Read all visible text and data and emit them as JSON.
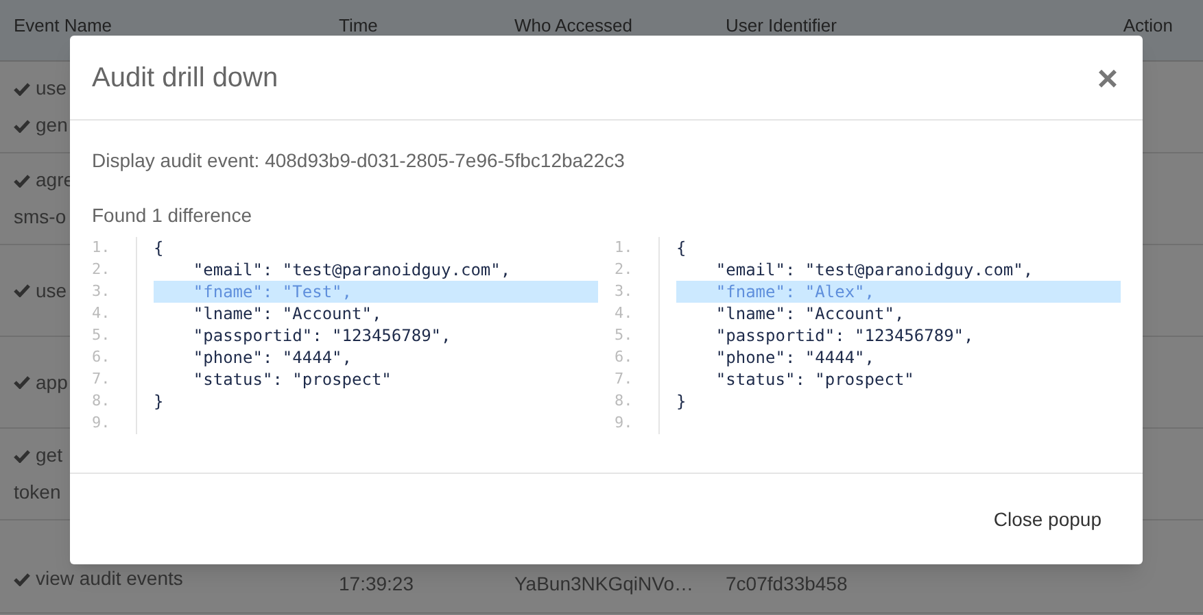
{
  "table": {
    "columns": [
      "Event Name",
      "Time",
      "Who Accessed",
      "User Identifier",
      "Action"
    ],
    "rows": [
      {
        "event": [
          {
            "kind": "check",
            "text": "use"
          },
          {
            "kind": "check",
            "text": "gen"
          }
        ]
      },
      {
        "event": [
          {
            "kind": "check",
            "text": "agre"
          },
          {
            "kind": "text",
            "text": "sms-o"
          }
        ]
      },
      {
        "event": [
          {
            "kind": "check",
            "text": "use"
          }
        ]
      },
      {
        "event": [
          {
            "kind": "check",
            "text": "app"
          }
        ]
      },
      {
        "event": [
          {
            "kind": "check",
            "text": "get"
          },
          {
            "kind": "text",
            "text": "token"
          }
        ]
      },
      {
        "event": [
          {
            "kind": "check",
            "text": "view audit events"
          }
        ],
        "time": "17:39:23",
        "who": "YaBun3NKGqiNVo…",
        "user_id": "7c07fd33b458"
      }
    ]
  },
  "modal": {
    "title": "Audit drill down",
    "close": "×",
    "event_line": "Display audit event: 408d93b9-d031-2805-7e96-5fbc12ba22c3",
    "summary": "Found 1 difference",
    "panes": [
      {
        "lines": [
          {
            "number": "1.",
            "text": "{",
            "changed": false
          },
          {
            "number": "2.",
            "text": "    \"email\": \"test@paranoidguy.com\",",
            "changed": false
          },
          {
            "number": "3.",
            "text": "    \"fname\": \"Test\",",
            "changed": true
          },
          {
            "number": "4.",
            "text": "    \"lname\": \"Account\",",
            "changed": false
          },
          {
            "number": "5.",
            "text": "    \"passportid\": \"123456789\",",
            "changed": false
          },
          {
            "number": "6.",
            "text": "    \"phone\": \"4444\",",
            "changed": false
          },
          {
            "number": "7.",
            "text": "    \"status\": \"prospect\"",
            "changed": false
          },
          {
            "number": "8.",
            "text": "}",
            "changed": false
          },
          {
            "number": "9."
          }
        ]
      },
      {
        "lines": [
          {
            "number": "1.",
            "text": "{",
            "changed": false
          },
          {
            "number": "2.",
            "text": "    \"email\": \"test@paranoidguy.com\",",
            "changed": false
          },
          {
            "number": "3.",
            "text": "    \"fname\": \"Alex\",",
            "changed": true
          },
          {
            "number": "4.",
            "text": "    \"lname\": \"Account\",",
            "changed": false
          },
          {
            "number": "5.",
            "text": "    \"passportid\": \"123456789\",",
            "changed": false
          },
          {
            "number": "6.",
            "text": "    \"phone\": \"4444\",",
            "changed": false
          },
          {
            "number": "7.",
            "text": "    \"status\": \"prospect\"",
            "changed": false
          },
          {
            "number": "8.",
            "text": "}",
            "changed": false
          },
          {
            "number": "9."
          }
        ]
      }
    ],
    "button": "Close popup"
  }
}
